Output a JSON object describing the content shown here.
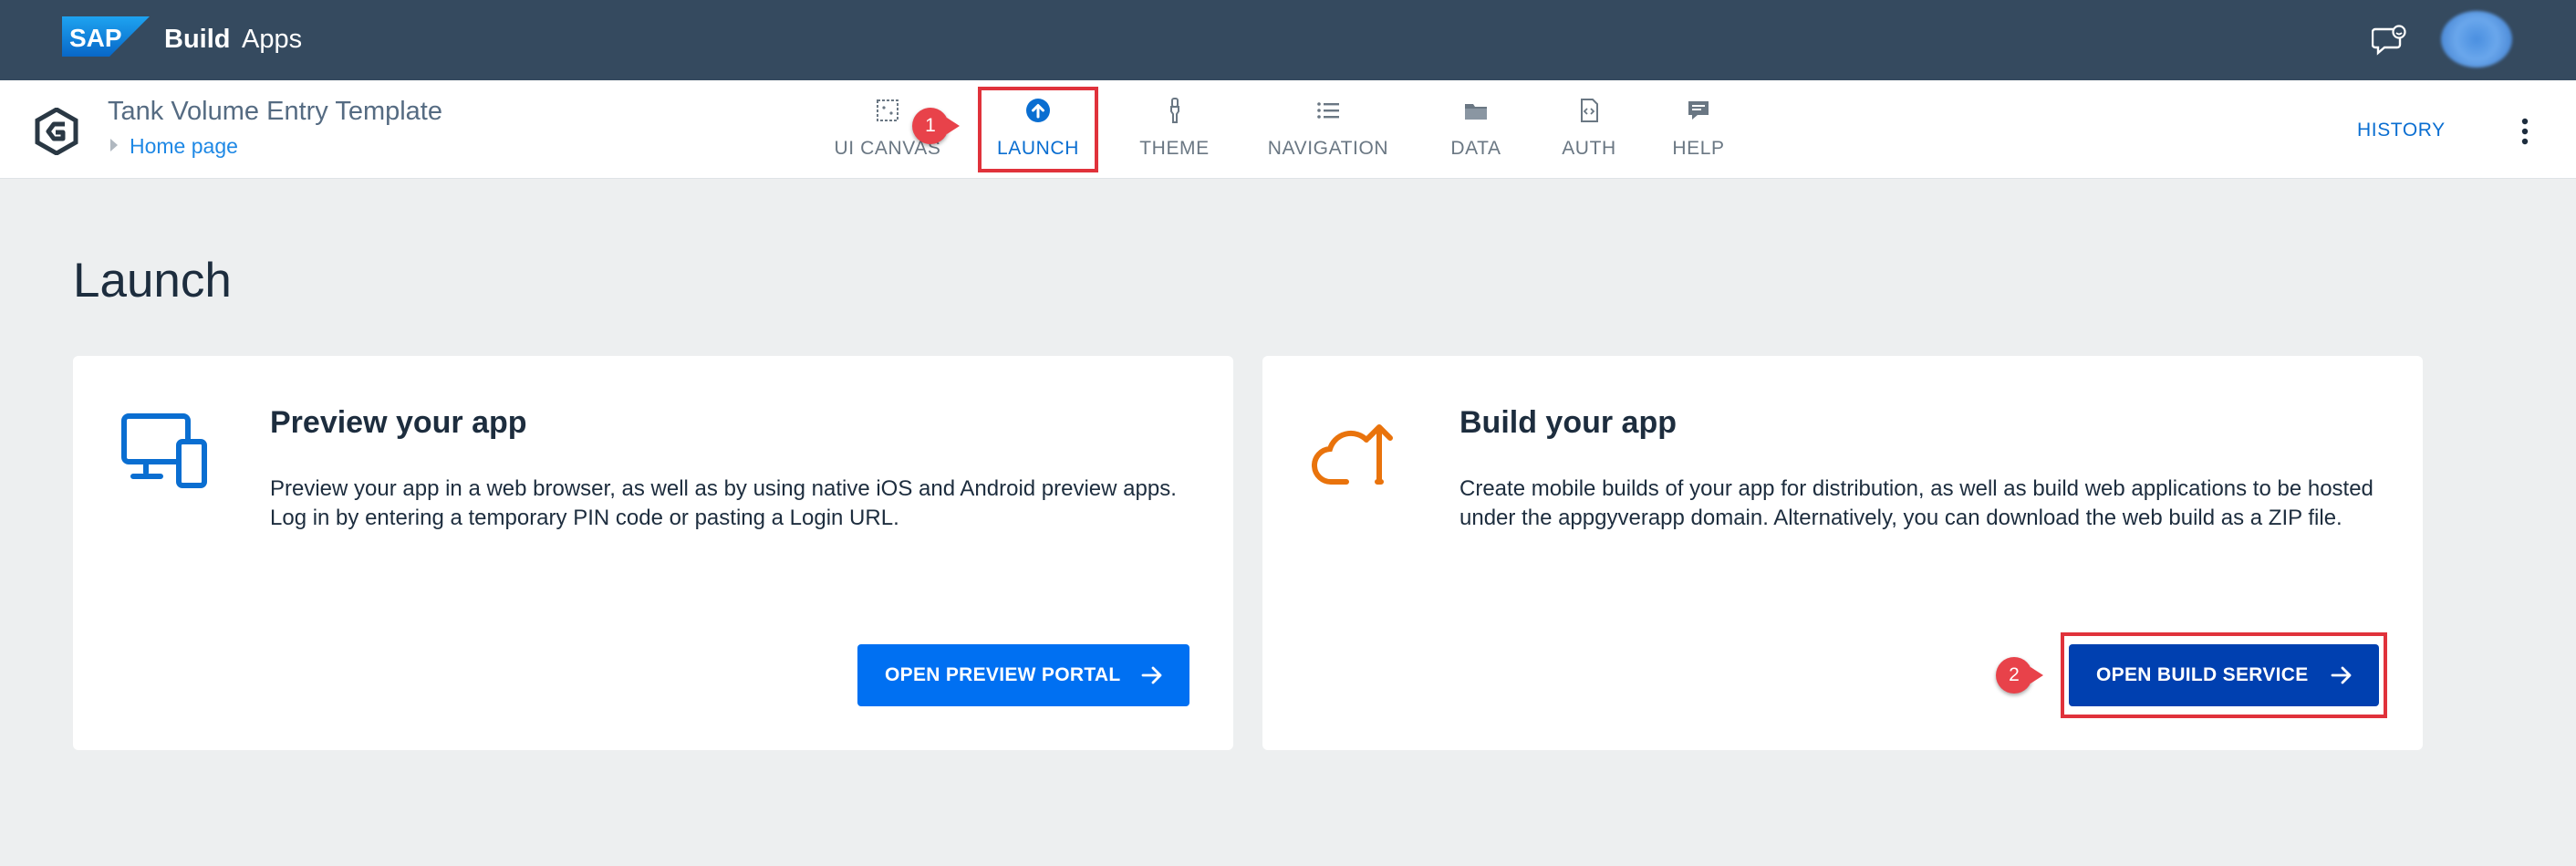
{
  "shell": {
    "logo_text": "SAP",
    "product_bold": "Build",
    "product_name": "Apps"
  },
  "app": {
    "title": "Tank Volume Entry Template",
    "breadcrumb": "Home page"
  },
  "tabs": [
    {
      "label": "UI CANVAS",
      "icon": "canvas-icon"
    },
    {
      "label": "LAUNCH",
      "icon": "launch-upload-icon",
      "active": true
    },
    {
      "label": "THEME",
      "icon": "brush-icon"
    },
    {
      "label": "NAVIGATION",
      "icon": "list-icon"
    },
    {
      "label": "DATA",
      "icon": "folder-icon"
    },
    {
      "label": "AUTH",
      "icon": "code-file-icon"
    },
    {
      "label": "HELP",
      "icon": "chat-icon"
    }
  ],
  "header_actions": {
    "history": "HISTORY"
  },
  "page": {
    "title": "Launch"
  },
  "cards": {
    "preview": {
      "heading": "Preview your app",
      "text": "Preview your app in a web browser, as well as by using native iOS and Android preview apps. Log in by entering a temporary PIN code or pasting a Login URL.",
      "button": "OPEN PREVIEW PORTAL"
    },
    "build": {
      "heading": "Build your app",
      "text": "Create mobile builds of your app for distribution, as well as build web applications to be hosted under the appgyverapp domain. Alternatively, you can download the web build as a ZIP file.",
      "button": "OPEN BUILD SERVICE"
    }
  },
  "annotations": {
    "step1": "1",
    "step2": "2"
  },
  "colors": {
    "shell_bg": "#354a5f",
    "accent": "#0a6ed1",
    "preview_button": "#0070f2",
    "build_button": "#0040b0",
    "callout": "#e0323b",
    "cloud_icon": "#e9730c"
  }
}
